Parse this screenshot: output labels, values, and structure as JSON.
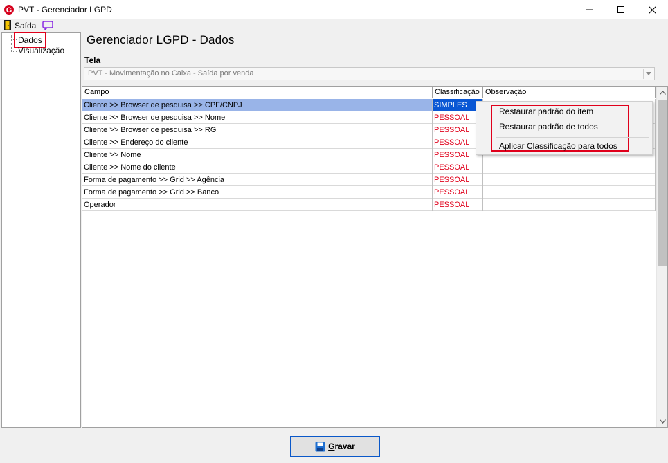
{
  "window": {
    "title": "PVT - Gerenciador LGPD",
    "logo_letter": "G",
    "minimize_icon": "minimize-icon",
    "maximize_icon": "maximize-icon",
    "close_icon": "close-icon"
  },
  "menu": {
    "exit_label": "Saída",
    "exit_icon": "door-exit-icon",
    "chat_icon": "chat-icon"
  },
  "tree": {
    "items": [
      {
        "label": "Dados"
      },
      {
        "label": "Visualização"
      }
    ]
  },
  "page": {
    "title": "Gerenciador LGPD - Dados",
    "tela_label": "Tela",
    "tela_value": "PVT - Movimentação no Caixa - Saída por venda"
  },
  "grid": {
    "headers": {
      "campo": "Campo",
      "classificacao": "Classificação",
      "observacao": "Observação"
    },
    "rows": [
      {
        "campo": "Cliente  >> Browser de pesquisa >> CPF/CNPJ",
        "classificacao": "SIMPLES",
        "observacao": ""
      },
      {
        "campo": "Cliente  >> Browser de pesquisa >> Nome",
        "classificacao": "PESSOAL",
        "observacao": ""
      },
      {
        "campo": "Cliente  >> Browser de pesquisa >> RG",
        "classificacao": "PESSOAL",
        "observacao": ""
      },
      {
        "campo": "Cliente >> Endereço do cliente",
        "classificacao": "PESSOAL",
        "observacao": ""
      },
      {
        "campo": "Cliente >> Nome",
        "classificacao": "PESSOAL",
        "observacao": ""
      },
      {
        "campo": "Cliente >> Nome do cliente",
        "classificacao": "PESSOAL",
        "observacao": ""
      },
      {
        "campo": "Forma de pagamento >> Grid >> Agência",
        "classificacao": "PESSOAL",
        "observacao": ""
      },
      {
        "campo": "Forma de pagamento >> Grid >> Banco",
        "classificacao": "PESSOAL",
        "observacao": ""
      },
      {
        "campo": "Operador",
        "classificacao": "PESSOAL",
        "observacao": ""
      }
    ]
  },
  "context_menu": {
    "items": [
      {
        "label": "Restaurar padrão do item"
      },
      {
        "label": "Restaurar padrão de todos"
      },
      {
        "label": "Aplicar Classificação para todos"
      }
    ]
  },
  "footer": {
    "save_label_first": "G",
    "save_label_rest": "ravar",
    "save_icon": "floppy-disk-icon"
  },
  "colors": {
    "accent_red": "#e0001b",
    "selection_blue": "#0a57d4",
    "row_selection": "#99b4e8"
  }
}
